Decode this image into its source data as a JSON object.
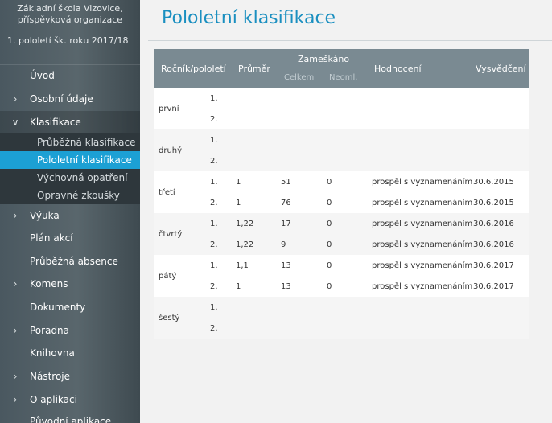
{
  "sidebar": {
    "school_line1": "Základní škola Vizovice,",
    "school_line2": "příspěvková organizace",
    "period": "1. pololetí šk. roku 2017/18",
    "items": [
      {
        "label": "Úvod",
        "arrow": ""
      },
      {
        "label": "Osobní údaje",
        "arrow": "›"
      },
      {
        "label": "Klasifikace",
        "arrow": "∨"
      },
      {
        "label": "Výuka",
        "arrow": "›"
      },
      {
        "label": "Plán akcí",
        "arrow": ""
      },
      {
        "label": "Průběžná absence",
        "arrow": ""
      },
      {
        "label": "Komens",
        "arrow": "›"
      },
      {
        "label": "Dokumenty",
        "arrow": ""
      },
      {
        "label": "Poradna",
        "arrow": "›"
      },
      {
        "label": "Knihovna",
        "arrow": ""
      },
      {
        "label": "Nástroje",
        "arrow": "›"
      },
      {
        "label": "O aplikaci",
        "arrow": "›"
      },
      {
        "label": "Původní aplikace",
        "arrow": ""
      }
    ],
    "sub_items": [
      {
        "label": "Průběžná klasifikace"
      },
      {
        "label": "Pololetní klasifikace"
      },
      {
        "label": "Výchovná opatření"
      },
      {
        "label": "Opravné zkoušky"
      }
    ]
  },
  "main": {
    "title": "Pololetní klasifikace",
    "table": {
      "headers": {
        "grade": "Ročník/pololetí",
        "average": "Průměr",
        "missed": "Zameškáno",
        "missed_total": "Celkem",
        "missed_unexcused": "Neoml.",
        "evaluation": "Hodnocení",
        "certificate": "Vysvědčení"
      },
      "groups": [
        {
          "grade": "první",
          "rows": [
            {
              "half": "1.",
              "average": "",
              "total": "",
              "unexcused": "",
              "evaluation": "",
              "date": ""
            },
            {
              "half": "2.",
              "average": "",
              "total": "",
              "unexcused": "",
              "evaluation": "",
              "date": ""
            }
          ]
        },
        {
          "grade": "druhý",
          "rows": [
            {
              "half": "1.",
              "average": "",
              "total": "",
              "unexcused": "",
              "evaluation": "",
              "date": ""
            },
            {
              "half": "2.",
              "average": "",
              "total": "",
              "unexcused": "",
              "evaluation": "",
              "date": ""
            }
          ]
        },
        {
          "grade": "třetí",
          "rows": [
            {
              "half": "1.",
              "average": "1",
              "total": "51",
              "unexcused": "0",
              "evaluation": "prospěl s vyznamenáním",
              "date": "30.6.2015"
            },
            {
              "half": "2.",
              "average": "1",
              "total": "76",
              "unexcused": "0",
              "evaluation": "prospěl s vyznamenáním",
              "date": "30.6.2015"
            }
          ]
        },
        {
          "grade": "čtvrtý",
          "rows": [
            {
              "half": "1.",
              "average": "1,22",
              "total": "17",
              "unexcused": "0",
              "evaluation": "prospěl s vyznamenáním",
              "date": "30.6.2016"
            },
            {
              "half": "2.",
              "average": "1,22",
              "total": "9",
              "unexcused": "0",
              "evaluation": "prospěl s vyznamenáním",
              "date": "30.6.2016"
            }
          ]
        },
        {
          "grade": "pátý",
          "rows": [
            {
              "half": "1.",
              "average": "1,1",
              "total": "13",
              "unexcused": "0",
              "evaluation": "prospěl s vyznamenáním",
              "date": "30.6.2017"
            },
            {
              "half": "2.",
              "average": "1",
              "total": "13",
              "unexcused": "0",
              "evaluation": "prospěl s vyznamenáním",
              "date": "30.6.2017"
            }
          ]
        },
        {
          "grade": "šestý",
          "rows": [
            {
              "half": "1.",
              "average": "",
              "total": "",
              "unexcused": "",
              "evaluation": "",
              "date": ""
            },
            {
              "half": "2.",
              "average": "",
              "total": "",
              "unexcused": "",
              "evaluation": "",
              "date": ""
            }
          ]
        }
      ]
    }
  },
  "colors": {
    "accent": "#1ca0d4",
    "title": "#1a8fc0",
    "table_header": "#7a8a92",
    "sidebar": "#4a5860"
  }
}
